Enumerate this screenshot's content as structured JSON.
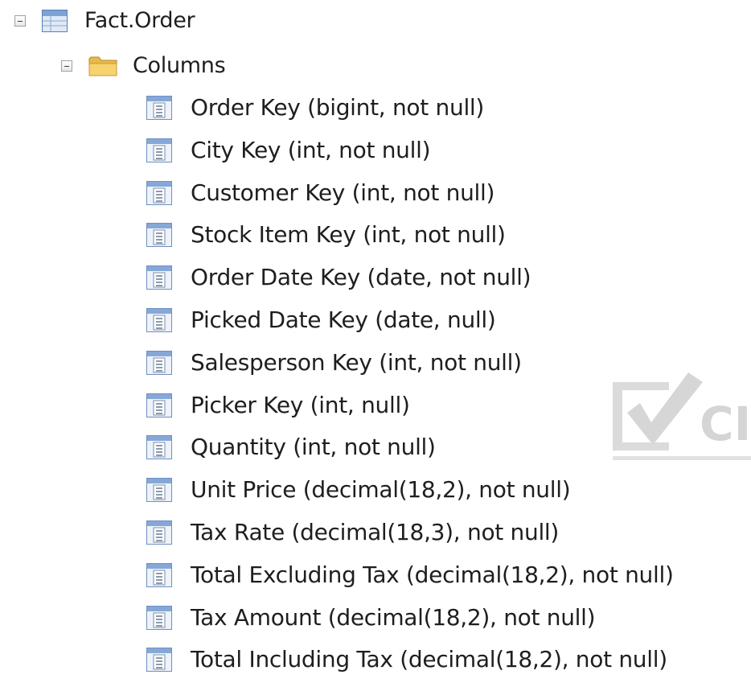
{
  "tree": {
    "table": {
      "label": "Fact.Order",
      "icon": "table-icon",
      "expanded": true
    },
    "folder": {
      "label": "Columns",
      "icon": "folder-icon",
      "expanded": true
    },
    "columns": [
      "Order Key (bigint, not null)",
      "City Key (int, not null)",
      "Customer Key (int, not null)",
      "Stock Item Key (int, not null)",
      "Order Date Key (date, not null)",
      "Picked Date Key (date, null)",
      "Salesperson Key (int, not null)",
      "Picker Key (int, null)",
      "Quantity (int, not null)",
      "Unit Price (decimal(18,2), not null)",
      "Tax Rate (decimal(18,3), not null)",
      "Total Excluding Tax (decimal(18,2), not null)",
      "Tax Amount (decimal(18,2), not null)",
      "Total Including Tax (decimal(18,2), not null)"
    ],
    "column_icon": "column-icon"
  },
  "watermark": {
    "text": "CI"
  }
}
